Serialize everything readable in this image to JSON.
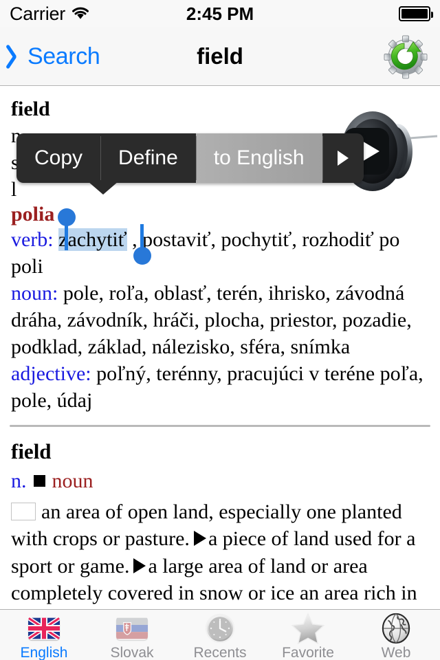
{
  "status_bar": {
    "carrier": "Carrier",
    "wifi_icon": "wifi-icon",
    "time": "2:45 PM",
    "battery_icon": "battery-full-icon"
  },
  "nav_bar": {
    "back_label": "Search",
    "back_icon": "chevron-left-icon",
    "title": "field",
    "action_icon": "gear-refresh-icon"
  },
  "content": {
    "entry_headword": "field",
    "hidden_line_1": "n",
    "hidden_line_2": "s",
    "hidden_line_3": "l",
    "plural_form": "polia",
    "verb_label": "verb:",
    "verb_selected": "zachytiť",
    "verb_rest": ", postaviť, pochytiť, rozhodiť po poli",
    "noun_label": "noun:",
    "noun_text": "pole, roľa, oblasť, terén, ihrisko, závodná dráha, závodník, hráči, plocha, priestor, pozadie, podklad, základ, nálezisko, sféra, snímka",
    "adjective_label": "adjective:",
    "adjective_text": "poľný, terénny, pracujúci v teréne poľa, pole, údaj"
  },
  "definition": {
    "headword": "field",
    "abbr": "n.",
    "pos_name": "noun",
    "sense_1": "an area of open land, especially one planted with crops or pasture.",
    "sense_2": "a piece of land used for a sport or game.",
    "sense_3": "a large area of land",
    "sense_4_obscured": "or area completely covered in snow or ice",
    "sense_5_obscured": "an area rich in a natural product, typically"
  },
  "speaker": {
    "icon": "speaker-play-icon",
    "play_glyph": "▶"
  },
  "popup_menu": {
    "items": [
      {
        "label": "Copy",
        "name": "copy",
        "highlighted": false
      },
      {
        "label": "Define",
        "name": "define",
        "highlighted": false
      },
      {
        "label": "to English",
        "name": "to-english",
        "highlighted": true
      }
    ],
    "more_arrow_icon": "caret-right-icon"
  },
  "tab_bar": {
    "tabs": [
      {
        "label": "English",
        "icon": "uk-flag-icon",
        "active": true
      },
      {
        "label": "Slovak",
        "icon": "slovakia-flag-icon",
        "active": false
      },
      {
        "label": "Recents",
        "icon": "clock-icon",
        "active": false
      },
      {
        "label": "Favorite",
        "icon": "star-icon",
        "active": false
      },
      {
        "label": "Web",
        "icon": "globe-icon",
        "active": false
      }
    ]
  },
  "colors": {
    "accent_blue": "#0a7bff",
    "pos_blue": "#1a1ae0",
    "headword_red": "#9b2020",
    "selection_blue": "#bcd6ef",
    "handle_blue": "#2878d8",
    "tab_inactive": "#8e8e92",
    "chrome_bg": "#f7f7f7"
  }
}
